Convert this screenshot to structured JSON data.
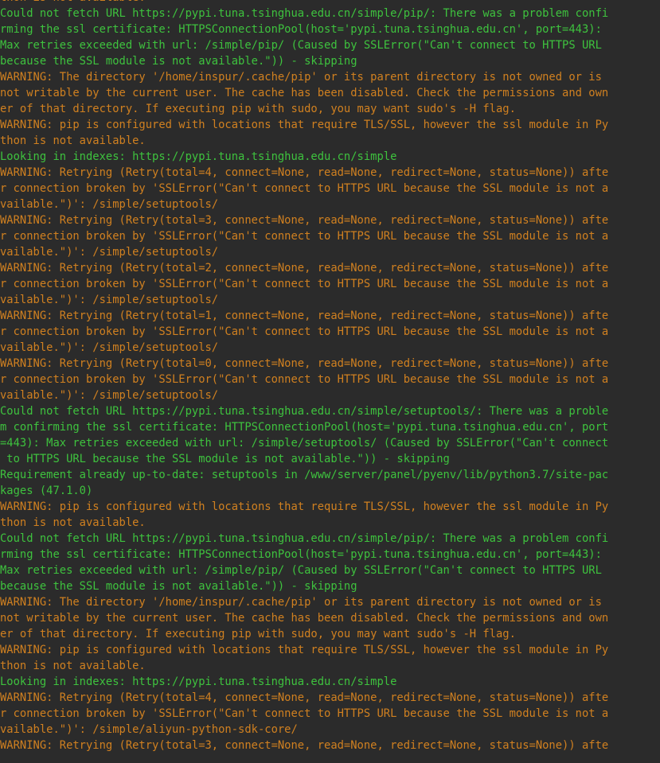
{
  "colors": {
    "background": "#2b2b2b",
    "info_text": "#3ec23e",
    "warning_text": "#d08020"
  },
  "lines": [
    {
      "kind": "warning",
      "text": "thon is not available."
    },
    {
      "kind": "info",
      "text": "Could not fetch URL https://pypi.tuna.tsinghua.edu.cn/simple/pip/: There was a problem confi"
    },
    {
      "kind": "info",
      "text": "rming the ssl certificate: HTTPSConnectionPool(host='pypi.tuna.tsinghua.edu.cn', port=443):"
    },
    {
      "kind": "info",
      "text": "Max retries exceeded with url: /simple/pip/ (Caused by SSLError(\"Can't connect to HTTPS URL"
    },
    {
      "kind": "info",
      "text": "because the SSL module is not available.\")) - skipping"
    },
    {
      "kind": "warning",
      "text": "WARNING: The directory '/home/inspur/.cache/pip' or its parent directory is not owned or is"
    },
    {
      "kind": "warning",
      "text": "not writable by the current user. The cache has been disabled. Check the permissions and own"
    },
    {
      "kind": "warning",
      "text": "er of that directory. If executing pip with sudo, you may want sudo's -H flag."
    },
    {
      "kind": "warning",
      "text": "WARNING: pip is configured with locations that require TLS/SSL, however the ssl module in Py"
    },
    {
      "kind": "warning",
      "text": "thon is not available."
    },
    {
      "kind": "info",
      "text": "Looking in indexes: https://pypi.tuna.tsinghua.edu.cn/simple"
    },
    {
      "kind": "warning",
      "text": "WARNING: Retrying (Retry(total=4, connect=None, read=None, redirect=None, status=None)) afte"
    },
    {
      "kind": "warning",
      "text": "r connection broken by 'SSLError(\"Can't connect to HTTPS URL because the SSL module is not a"
    },
    {
      "kind": "warning",
      "text": "vailable.\")': /simple/setuptools/"
    },
    {
      "kind": "warning",
      "text": "WARNING: Retrying (Retry(total=3, connect=None, read=None, redirect=None, status=None)) afte"
    },
    {
      "kind": "warning",
      "text": "r connection broken by 'SSLError(\"Can't connect to HTTPS URL because the SSL module is not a"
    },
    {
      "kind": "warning",
      "text": "vailable.\")': /simple/setuptools/"
    },
    {
      "kind": "warning",
      "text": "WARNING: Retrying (Retry(total=2, connect=None, read=None, redirect=None, status=None)) afte"
    },
    {
      "kind": "warning",
      "text": "r connection broken by 'SSLError(\"Can't connect to HTTPS URL because the SSL module is not a"
    },
    {
      "kind": "warning",
      "text": "vailable.\")': /simple/setuptools/"
    },
    {
      "kind": "warning",
      "text": "WARNING: Retrying (Retry(total=1, connect=None, read=None, redirect=None, status=None)) afte"
    },
    {
      "kind": "warning",
      "text": "r connection broken by 'SSLError(\"Can't connect to HTTPS URL because the SSL module is not a"
    },
    {
      "kind": "warning",
      "text": "vailable.\")': /simple/setuptools/"
    },
    {
      "kind": "warning",
      "text": "WARNING: Retrying (Retry(total=0, connect=None, read=None, redirect=None, status=None)) afte"
    },
    {
      "kind": "warning",
      "text": "r connection broken by 'SSLError(\"Can't connect to HTTPS URL because the SSL module is not a"
    },
    {
      "kind": "warning",
      "text": "vailable.\")': /simple/setuptools/"
    },
    {
      "kind": "info",
      "text": "Could not fetch URL https://pypi.tuna.tsinghua.edu.cn/simple/setuptools/: There was a proble"
    },
    {
      "kind": "info",
      "text": "m confirming the ssl certificate: HTTPSConnectionPool(host='pypi.tuna.tsinghua.edu.cn', port"
    },
    {
      "kind": "info",
      "text": "=443): Max retries exceeded with url: /simple/setuptools/ (Caused by SSLError(\"Can't connect"
    },
    {
      "kind": "info",
      "text": " to HTTPS URL because the SSL module is not available.\")) - skipping"
    },
    {
      "kind": "info",
      "text": "Requirement already up-to-date: setuptools in /www/server/panel/pyenv/lib/python3.7/site-pac"
    },
    {
      "kind": "info",
      "text": "kages (47.1.0)"
    },
    {
      "kind": "warning",
      "text": "WARNING: pip is configured with locations that require TLS/SSL, however the ssl module in Py"
    },
    {
      "kind": "warning",
      "text": "thon is not available."
    },
    {
      "kind": "info",
      "text": "Could not fetch URL https://pypi.tuna.tsinghua.edu.cn/simple/pip/: There was a problem confi"
    },
    {
      "kind": "info",
      "text": "rming the ssl certificate: HTTPSConnectionPool(host='pypi.tuna.tsinghua.edu.cn', port=443):"
    },
    {
      "kind": "info",
      "text": "Max retries exceeded with url: /simple/pip/ (Caused by SSLError(\"Can't connect to HTTPS URL"
    },
    {
      "kind": "info",
      "text": "because the SSL module is not available.\")) - skipping"
    },
    {
      "kind": "warning",
      "text": "WARNING: The directory '/home/inspur/.cache/pip' or its parent directory is not owned or is"
    },
    {
      "kind": "warning",
      "text": "not writable by the current user. The cache has been disabled. Check the permissions and own"
    },
    {
      "kind": "warning",
      "text": "er of that directory. If executing pip with sudo, you may want sudo's -H flag."
    },
    {
      "kind": "warning",
      "text": "WARNING: pip is configured with locations that require TLS/SSL, however the ssl module in Py"
    },
    {
      "kind": "warning",
      "text": "thon is not available."
    },
    {
      "kind": "info",
      "text": "Looking in indexes: https://pypi.tuna.tsinghua.edu.cn/simple"
    },
    {
      "kind": "warning",
      "text": "WARNING: Retrying (Retry(total=4, connect=None, read=None, redirect=None, status=None)) afte"
    },
    {
      "kind": "warning",
      "text": "r connection broken by 'SSLError(\"Can't connect to HTTPS URL because the SSL module is not a"
    },
    {
      "kind": "warning",
      "text": "vailable.\")': /simple/aliyun-python-sdk-core/"
    },
    {
      "kind": "warning",
      "text": "WARNING: Retrying (Retry(total=3, connect=None, read=None, redirect=None, status=None)) afte"
    }
  ]
}
